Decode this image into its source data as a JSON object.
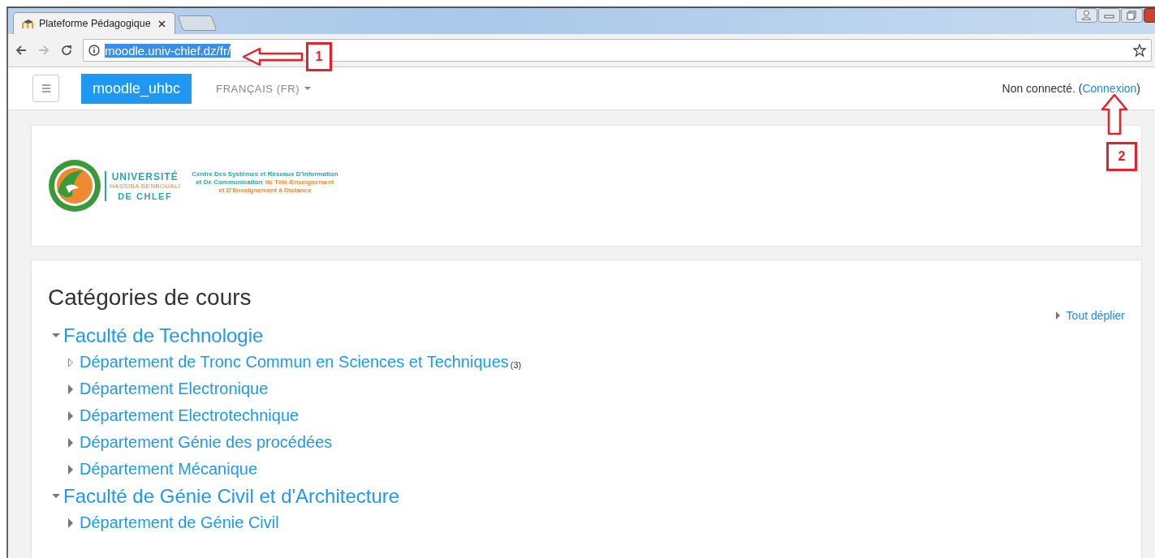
{
  "browser": {
    "tab": {
      "title": "Plateforme Pédagogique",
      "selected": true
    },
    "address": {
      "url": "moodle.univ-chlef.dz/fr/",
      "selected": true
    }
  },
  "navbar": {
    "brand": "moodle_uhbc",
    "language": "FRANÇAIS (FR)",
    "login_prefix": "Non connecté. (",
    "login_link": "Connexion",
    "login_suffix": ")"
  },
  "logo": {
    "university": [
      "UNIVERSITÉ",
      "HASSIBA BENBOUALI",
      "DE CHLEF"
    ],
    "centre_lines": [
      [
        {
          "text": "Centre Des Systèmes et Réseaux D'Information",
          "color": "#2aa6a6"
        }
      ],
      [
        {
          "text": "et De Communication",
          "color": "#2aa6a6"
        },
        {
          "text": "de Télé-Enseignement",
          "color": "#f08a32"
        }
      ],
      [
        {
          "text": "et D'Enseignement à Distance",
          "color": "#f08a32"
        }
      ]
    ]
  },
  "categories": {
    "title": "Catégories de cours",
    "expand_all": "Tout déplier",
    "items": [
      {
        "name": "Faculté de Technologie",
        "expanded": true,
        "children": [
          {
            "name": "Département de Tronc Commun en Sciences et Techniques",
            "count": "(3)",
            "has_subcategories": false
          },
          {
            "name": "Département Electronique",
            "has_subcategories": true
          },
          {
            "name": "Département Electrotechnique",
            "has_subcategories": true
          },
          {
            "name": "Département Génie des procédées",
            "has_subcategories": true
          },
          {
            "name": "Département Mécanique",
            "has_subcategories": true
          }
        ]
      },
      {
        "name": "Faculté de Génie Civil et d'Architecture",
        "expanded": true,
        "children": [
          {
            "name": "Département de Génie Civil",
            "has_subcategories": true
          }
        ]
      }
    ]
  },
  "annotations": [
    {
      "kind": "arrow-left",
      "label": "1"
    },
    {
      "kind": "arrow-up",
      "label": "2"
    }
  ]
}
